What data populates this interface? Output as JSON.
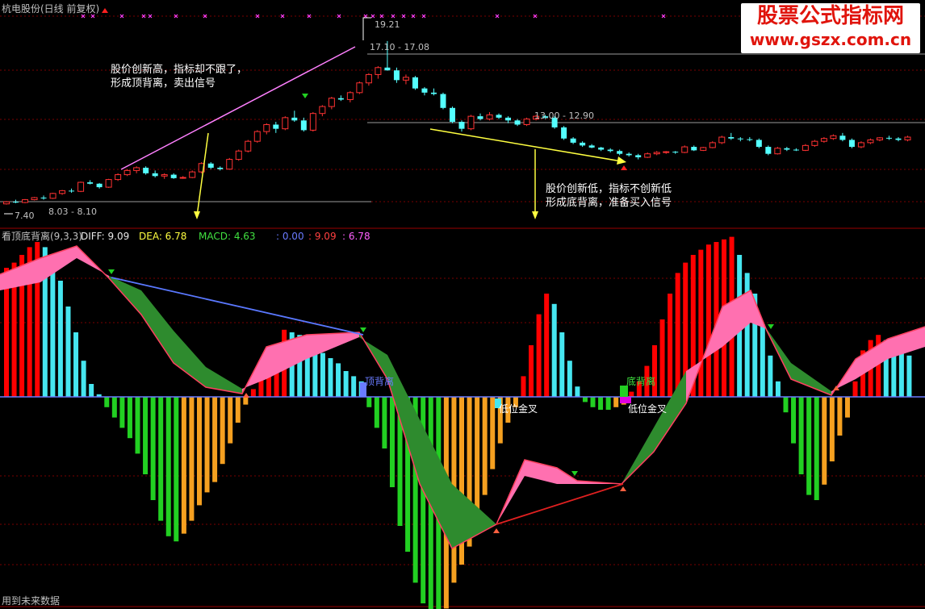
{
  "top_panel": {
    "title": "杭电股份(日线 前复权)",
    "high_label": "19.21",
    "high_range": "17.10 - 17.08",
    "mid_range": "13.00 - 12.90",
    "low_range": "8.03 - 8.10",
    "low_label": "7.40",
    "annotation_top": [
      "股价创新高，指标却不跟了，",
      "形成顶背离，卖出信号"
    ],
    "annotation_bottom": [
      "股价创新低，指标不创新低",
      "形成底背离，准备买入信号"
    ]
  },
  "indicator_bar": {
    "name": "看顶底背离(9,3,3)",
    "diff": "DIFF: 9.09",
    "dea": "DEA: 6.78",
    "macd": "MACD: 4.63",
    "v1": ": 0.00",
    "v2": ": 9.09",
    "v3": ": 6.78"
  },
  "bottom_panel": {
    "top_divergence": "顶背离",
    "bottom_divergence": "底背离",
    "low_cross_1": "低位金叉",
    "low_cross_2": "低位金叉",
    "footer": "用到未来数据"
  },
  "watermark": {
    "line1": "股票公式指标网",
    "line2": "www.gszx.com.cn"
  },
  "colors": {
    "up": "#ff3232",
    "down": "#54ffff",
    "macd_pos_up": "#ff0000",
    "macd_pos_down": "#46e6f0",
    "macd_neg_down": "#22d022",
    "macd_neg_up": "#f5a020",
    "band_bull": "#ff70b0",
    "band_bear": "#2e8b2e",
    "divergence_line": "#5a78ff",
    "annotation_arrow": "#ffff40",
    "trend_line": "#ff80ff"
  },
  "chart_data": [
    {
      "type": "candlestick",
      "title": "杭电股份(日线 前复权)",
      "ylim": [
        6.5,
        21.0
      ],
      "candles": [
        [
          7.5,
          7.7,
          7.45,
          7.65
        ],
        [
          7.65,
          7.8,
          7.55,
          7.6
        ],
        [
          7.6,
          7.85,
          7.55,
          7.8
        ],
        [
          7.8,
          8.0,
          7.75,
          7.95
        ],
        [
          7.95,
          8.1,
          7.8,
          7.9
        ],
        [
          7.9,
          8.3,
          7.85,
          8.25
        ],
        [
          8.25,
          8.5,
          8.15,
          8.45
        ],
        [
          8.45,
          8.6,
          8.3,
          8.4
        ],
        [
          8.4,
          9.1,
          8.35,
          9.05
        ],
        [
          9.05,
          9.2,
          8.9,
          8.95
        ],
        [
          8.95,
          9.0,
          8.6,
          8.7
        ],
        [
          8.7,
          9.3,
          8.65,
          9.25
        ],
        [
          9.25,
          9.7,
          9.15,
          9.6
        ],
        [
          9.6,
          10.0,
          9.5,
          9.9
        ],
        [
          9.9,
          10.2,
          9.7,
          10.1
        ],
        [
          10.1,
          10.2,
          9.6,
          9.7
        ],
        [
          9.7,
          9.9,
          9.4,
          9.5
        ],
        [
          9.5,
          9.7,
          9.3,
          9.6
        ],
        [
          9.6,
          9.7,
          9.3,
          9.35
        ],
        [
          9.35,
          9.5,
          9.3,
          9.4
        ],
        [
          9.4,
          9.9,
          9.35,
          9.8
        ],
        [
          9.8,
          10.5,
          9.7,
          10.4
        ],
        [
          10.4,
          10.5,
          10.0,
          10.1
        ],
        [
          10.1,
          10.2,
          9.9,
          10.0
        ],
        [
          10.0,
          10.8,
          9.95,
          10.7
        ],
        [
          10.7,
          11.4,
          10.6,
          11.3
        ],
        [
          11.3,
          12.1,
          11.2,
          12.0
        ],
        [
          12.0,
          12.8,
          11.9,
          12.7
        ],
        [
          12.7,
          13.3,
          12.5,
          13.2
        ],
        [
          13.2,
          13.4,
          12.6,
          12.9
        ],
        [
          12.9,
          13.8,
          12.8,
          13.7
        ],
        [
          13.7,
          14.2,
          13.4,
          13.5
        ],
        [
          13.5,
          13.7,
          12.7,
          12.8
        ],
        [
          12.8,
          14.1,
          12.7,
          14.0
        ],
        [
          14.0,
          14.6,
          13.8,
          14.5
        ],
        [
          14.5,
          15.2,
          14.3,
          15.1
        ],
        [
          15.1,
          15.3,
          14.9,
          15.0
        ],
        [
          15.0,
          15.6,
          14.8,
          15.5
        ],
        [
          15.5,
          16.3,
          15.4,
          16.2
        ],
        [
          16.2,
          16.9,
          16.0,
          16.8
        ],
        [
          16.8,
          17.4,
          16.5,
          17.3
        ],
        [
          17.3,
          19.21,
          17.08,
          17.1
        ],
        [
          17.1,
          17.3,
          16.2,
          16.4
        ],
        [
          16.4,
          16.8,
          16.1,
          16.6
        ],
        [
          16.6,
          16.7,
          15.7,
          15.8
        ],
        [
          15.8,
          15.9,
          15.3,
          15.5
        ],
        [
          15.5,
          15.8,
          15.3,
          15.4
        ],
        [
          15.4,
          15.5,
          14.3,
          14.4
        ],
        [
          14.4,
          14.5,
          13.3,
          13.4
        ],
        [
          13.4,
          13.5,
          12.7,
          12.9
        ],
        [
          12.9,
          13.9,
          12.8,
          13.8
        ],
        [
          13.8,
          14.0,
          13.5,
          13.6
        ],
        [
          13.6,
          14.1,
          13.5,
          13.9
        ],
        [
          13.9,
          14.0,
          13.6,
          13.7
        ],
        [
          13.7,
          13.8,
          13.3,
          13.5
        ],
        [
          13.5,
          13.6,
          13.1,
          13.2
        ],
        [
          13.2,
          13.7,
          13.1,
          13.6
        ],
        [
          13.6,
          13.9,
          13.5,
          13.8
        ],
        [
          13.8,
          13.9,
          13.6,
          13.7
        ],
        [
          13.7,
          13.8,
          12.9,
          13.0
        ],
        [
          13.0,
          13.1,
          12.1,
          12.2
        ],
        [
          12.2,
          12.3,
          11.8,
          11.9
        ],
        [
          11.9,
          12.0,
          11.6,
          11.7
        ],
        [
          11.7,
          11.8,
          11.5,
          11.55
        ],
        [
          11.55,
          11.6,
          11.3,
          11.4
        ],
        [
          11.4,
          11.5,
          11.2,
          11.3
        ],
        [
          11.3,
          11.4,
          11.0,
          11.1
        ],
        [
          11.1,
          11.2,
          10.9,
          11.0
        ],
        [
          11.0,
          11.1,
          10.7,
          10.85
        ],
        [
          10.85,
          11.2,
          10.8,
          11.1
        ],
        [
          11.1,
          11.3,
          11.0,
          11.2
        ],
        [
          11.2,
          11.3,
          11.1,
          11.25
        ],
        [
          11.25,
          11.3,
          11.1,
          11.2
        ],
        [
          11.2,
          11.7,
          11.15,
          11.6
        ],
        [
          11.6,
          11.7,
          11.3,
          11.35
        ],
        [
          11.35,
          11.6,
          11.3,
          11.55
        ],
        [
          11.55,
          12.0,
          11.5,
          11.9
        ],
        [
          11.9,
          12.4,
          11.8,
          12.3
        ],
        [
          12.3,
          12.6,
          12.1,
          12.2
        ],
        [
          12.2,
          12.3,
          12.0,
          12.15
        ],
        [
          12.15,
          12.3,
          12.0,
          12.1
        ],
        [
          12.1,
          12.2,
          11.5,
          11.6
        ],
        [
          11.6,
          11.7,
          11.0,
          11.1
        ],
        [
          11.1,
          11.6,
          11.05,
          11.5
        ],
        [
          11.5,
          11.6,
          11.3,
          11.4
        ],
        [
          11.4,
          11.5,
          11.3,
          11.35
        ],
        [
          11.35,
          11.8,
          11.3,
          11.7
        ],
        [
          11.7,
          12.1,
          11.6,
          12.0
        ],
        [
          12.0,
          12.3,
          11.9,
          12.2
        ],
        [
          12.2,
          12.5,
          12.1,
          12.4
        ],
        [
          12.4,
          12.6,
          12.0,
          12.1
        ],
        [
          12.1,
          12.2,
          11.5,
          11.6
        ],
        [
          11.6,
          12.0,
          11.5,
          11.9
        ],
        [
          11.9,
          12.2,
          11.8,
          12.1
        ],
        [
          12.1,
          12.3,
          12.0,
          12.25
        ],
        [
          12.25,
          12.4,
          12.1,
          12.2
        ],
        [
          12.2,
          12.3,
          12.0,
          12.1
        ],
        [
          12.1,
          12.4,
          12.0,
          12.3
        ]
      ]
    },
    {
      "type": "bar",
      "title": "看顶底背离(9,3,3)",
      "ylim": [
        -1.0,
        0.6
      ],
      "macd": [
        0.5,
        0.52,
        0.55,
        0.58,
        0.6,
        0.58,
        0.52,
        0.45,
        0.35,
        0.25,
        0.14,
        0.05,
        0.01,
        -0.04,
        -0.08,
        -0.12,
        -0.16,
        -0.22,
        -0.3,
        -0.4,
        -0.48,
        -0.54,
        -0.56,
        -0.53,
        -0.48,
        -0.42,
        -0.37,
        -0.33,
        -0.26,
        -0.18,
        -0.1,
        -0.03,
        0.03,
        0.08,
        0.15,
        0.2,
        0.26,
        0.25,
        0.24,
        0.21,
        0.19,
        0.17,
        0.15,
        0.13,
        0.1,
        0.08,
        0.06,
        -0.04,
        -0.12,
        -0.2,
        -0.35,
        -0.5,
        -0.6,
        -0.72,
        -0.8,
        -0.85,
        -0.9,
        -0.82,
        -0.72,
        -0.65,
        -0.58,
        -0.48,
        -0.38,
        -0.28,
        -0.18,
        -0.1,
        -0.04,
        0.08,
        0.2,
        0.32,
        0.4,
        0.36,
        0.25,
        0.14,
        0.04,
        -0.02,
        -0.04,
        -0.05,
        -0.05,
        -0.04,
        -0.03,
        0.02,
        0.06,
        0.12,
        0.2,
        0.3,
        0.4,
        0.48,
        0.52,
        0.55,
        0.57,
        0.59,
        0.6,
        0.61,
        0.62,
        0.55,
        0.48,
        0.4,
        0.28,
        0.16,
        0.06,
        -0.06,
        -0.18,
        -0.3,
        -0.38,
        -0.4,
        -0.34,
        -0.25,
        -0.15,
        -0.08,
        0.06,
        0.18,
        0.22,
        0.24,
        0.22,
        0.2,
        0.18,
        0.16
      ]
    }
  ]
}
